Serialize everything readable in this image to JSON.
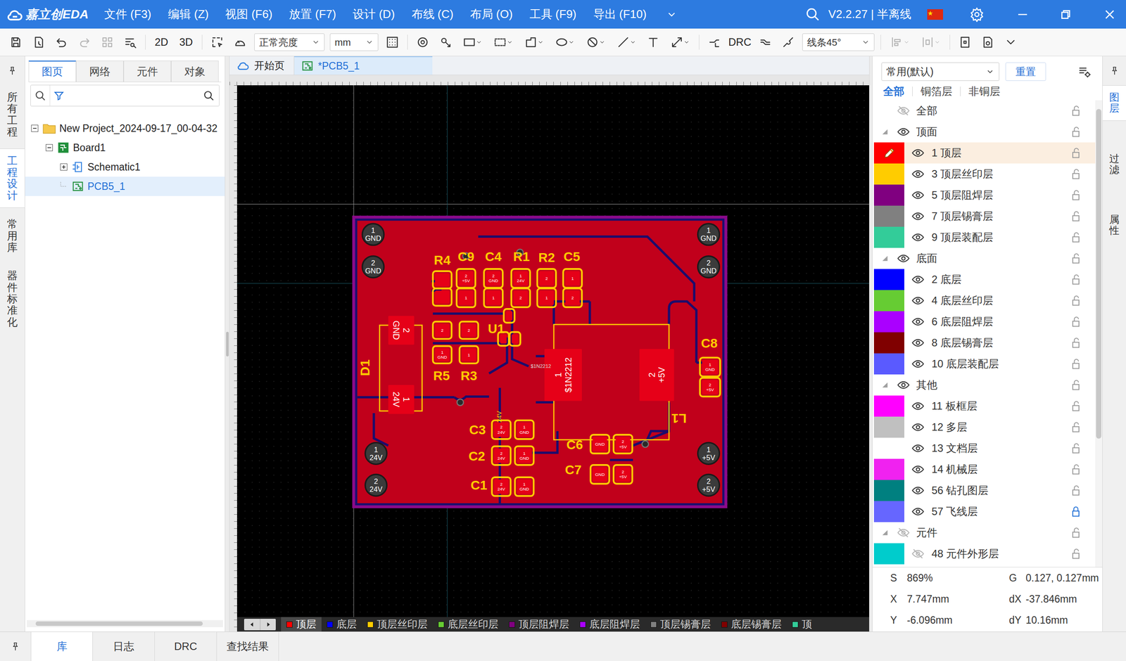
{
  "app": {
    "logo": "嘉立创EDA",
    "version": "V2.2.27 | 半离线"
  },
  "menu": [
    "文件 (F3)",
    "编辑 (Z)",
    "视图 (F6)",
    "放置 (F7)",
    "设计 (D)",
    "布线 (C)",
    "布局 (O)",
    "工具 (F9)",
    "导出 (F10)"
  ],
  "toolbar": {
    "view2d": "2D",
    "view3d": "3D",
    "brightness": "正常亮度",
    "units": "mm",
    "drc": "DRC",
    "route_mode": "线条45°"
  },
  "left_strip": [
    {
      "label": "所有工程",
      "selected": false
    },
    {
      "label": "工程设计",
      "selected": true
    },
    {
      "label": "常用库",
      "selected": false
    },
    {
      "label": "器件标准化",
      "selected": false
    }
  ],
  "left_tabs": [
    {
      "label": "图页",
      "selected": true
    },
    {
      "label": "网络",
      "selected": false
    },
    {
      "label": "元件",
      "selected": false
    },
    {
      "label": "对象",
      "selected": false
    }
  ],
  "tree": [
    {
      "label": "New Project_2024-09-17_00-04-32",
      "kind": "project",
      "depth": 0,
      "expanded": true,
      "selected": false
    },
    {
      "label": "Board1",
      "kind": "board",
      "depth": 1,
      "expanded": true,
      "selected": false
    },
    {
      "label": "Schematic1",
      "kind": "schematic",
      "depth": 2,
      "expanded": false,
      "selected": false
    },
    {
      "label": "PCB5_1",
      "kind": "pcb",
      "depth": 2,
      "selected": true
    }
  ],
  "doc_tabs": [
    {
      "label": "开始页",
      "kind": "home",
      "selected": false
    },
    {
      "label": "*PCB5_1",
      "kind": "pcb",
      "selected": true
    }
  ],
  "pcb": {
    "holes": [
      {
        "num": "1",
        "net": "GND"
      },
      {
        "num": "2",
        "net": "GND"
      },
      {
        "num": "1",
        "net": "GND"
      },
      {
        "num": "2",
        "net": "GND"
      },
      {
        "num": "1",
        "net": "24V"
      },
      {
        "num": "2",
        "net": "24V"
      },
      {
        "num": "1",
        "net": "+5V"
      },
      {
        "num": "2",
        "net": "+5V"
      }
    ],
    "components": [
      {
        "ref": "R4",
        "pads": [
          {},
          {}
        ]
      },
      {
        "ref": "C9",
        "pads": [
          {
            "num": "2",
            "net": "+5V"
          },
          {
            "num": "1"
          }
        ]
      },
      {
        "ref": "C4",
        "pads": [
          {
            "num": "2",
            "net": "GND"
          },
          {
            "num": "1"
          }
        ]
      },
      {
        "ref": "R1",
        "pads": [
          {
            "num": "1",
            "net": "24V"
          },
          {
            "num": "2"
          }
        ]
      },
      {
        "ref": "R2",
        "pads": [
          {
            "num": "2"
          },
          {
            "num": "1"
          }
        ]
      },
      {
        "ref": "C5",
        "pads": [
          {
            "num": "1"
          },
          {
            "num": "2"
          }
        ]
      },
      {
        "ref": "U1",
        "pads": [
          {},
          {},
          {}
        ]
      },
      {
        "ref": "R5",
        "pads": [
          {
            "num": "2"
          },
          {
            "num": "1",
            "net": "GND"
          }
        ]
      },
      {
        "ref": "R3",
        "pads": [
          {
            "num": "2"
          },
          {
            "num": "1"
          }
        ]
      },
      {
        "ref": "D1",
        "pads": [
          {
            "num": "2",
            "net": "GND"
          },
          {
            "num": "1",
            "net": "24V"
          }
        ]
      },
      {
        "ref": "L1",
        "pads": [
          {
            "num": "1",
            "net": "$1N2212"
          },
          {
            "num": "2",
            "net": "+5V"
          }
        ]
      },
      {
        "ref": "C8",
        "pads": [
          {
            "num": "1",
            "net": "GND"
          },
          {
            "num": "2",
            "net": "+5V"
          }
        ]
      },
      {
        "ref": "C3",
        "pads": [
          {
            "num": "2",
            "net": "24V"
          },
          {
            "num": "1",
            "net": "GND"
          }
        ]
      },
      {
        "ref": "C2",
        "pads": [
          {
            "num": "2",
            "net": "24V"
          },
          {
            "num": "1",
            "net": "GND"
          }
        ]
      },
      {
        "ref": "C1",
        "pads": [
          {
            "num": "2",
            "net": "24V"
          },
          {
            "num": "1",
            "net": "GND"
          }
        ]
      },
      {
        "ref": "C6",
        "pads": [
          {
            "net": "GND"
          },
          {
            "num": "2",
            "net": "+5V"
          }
        ]
      },
      {
        "ref": "C7",
        "pads": [
          {
            "net": "GND"
          },
          {
            "num": "2",
            "net": "+5V"
          }
        ]
      }
    ],
    "notes": [
      "$1N2212",
      "24V"
    ]
  },
  "layer_tabs": [
    {
      "label": "顶层",
      "color": "#ff0000",
      "selected": true
    },
    {
      "label": "底层",
      "color": "#0000ff",
      "selected": false
    },
    {
      "label": "顶层丝印层",
      "color": "#ffcc00",
      "selected": false
    },
    {
      "label": "底层丝印层",
      "color": "#66cc33",
      "selected": false
    },
    {
      "label": "顶层阻焊层",
      "color": "#800080",
      "selected": false
    },
    {
      "label": "底层阻焊层",
      "color": "#aa00ff",
      "selected": false
    },
    {
      "label": "顶层锡膏层",
      "color": "#808080",
      "selected": false
    },
    {
      "label": "底层锡膏层",
      "color": "#800000",
      "selected": false
    },
    {
      "label": "顶",
      "color": "#33cc99",
      "selected": false
    }
  ],
  "layers_panel": {
    "preset": "常用(默认)",
    "reset": "重置",
    "filters": [
      {
        "label": "全部",
        "selected": true
      },
      {
        "label": "铜箔层",
        "selected": false
      },
      {
        "label": "非铜层",
        "selected": false
      }
    ],
    "rows": [
      {
        "kind": "all",
        "label": "全部",
        "visible": false,
        "locked": false
      },
      {
        "kind": "group",
        "label": "顶面",
        "expanded": true,
        "visible": true,
        "locked": false
      },
      {
        "kind": "layer",
        "label": "1 顶层",
        "color": "#ff0000",
        "visible": true,
        "active": true,
        "locked": false
      },
      {
        "kind": "layer",
        "label": "3 顶层丝印层",
        "color": "#ffcc00",
        "visible": true,
        "active": false,
        "locked": false
      },
      {
        "kind": "layer",
        "label": "5 顶层阻焊层",
        "color": "#800080",
        "visible": true,
        "active": false,
        "locked": false
      },
      {
        "kind": "layer",
        "label": "7 顶层锡膏层",
        "color": "#808080",
        "visible": true,
        "active": false,
        "locked": false
      },
      {
        "kind": "layer",
        "label": "9 顶层装配层",
        "color": "#33cc99",
        "visible": true,
        "active": false,
        "locked": false
      },
      {
        "kind": "group",
        "label": "底面",
        "expanded": true,
        "visible": true,
        "locked": false
      },
      {
        "kind": "layer",
        "label": "2 底层",
        "color": "#0000ff",
        "visible": true,
        "active": false,
        "locked": false
      },
      {
        "kind": "layer",
        "label": "4 底层丝印层",
        "color": "#66cc33",
        "visible": true,
        "active": false,
        "locked": false
      },
      {
        "kind": "layer",
        "label": "6 底层阻焊层",
        "color": "#aa00ff",
        "visible": true,
        "active": false,
        "locked": false
      },
      {
        "kind": "layer",
        "label": "8 底层锡膏层",
        "color": "#800000",
        "visible": true,
        "active": false,
        "locked": false
      },
      {
        "kind": "layer",
        "label": "10 底层装配层",
        "color": "#5a5aff",
        "visible": true,
        "active": false,
        "locked": false
      },
      {
        "kind": "group",
        "label": "其他",
        "expanded": true,
        "visible": true,
        "locked": false
      },
      {
        "kind": "layer",
        "label": "11 板框层",
        "color": "#ff00ff",
        "visible": true,
        "active": false,
        "locked": false
      },
      {
        "kind": "layer",
        "label": "12 多层",
        "color": "#c0c0c0",
        "visible": true,
        "active": false,
        "locked": false
      },
      {
        "kind": "layer",
        "label": "13 文档层",
        "color": "#ffffff",
        "visible": true,
        "active": false,
        "locked": false
      },
      {
        "kind": "layer",
        "label": "14 机械层",
        "color": "#f022f0",
        "visible": true,
        "active": false,
        "locked": false
      },
      {
        "kind": "layer",
        "label": "56 钻孔图层",
        "color": "#008080",
        "visible": true,
        "active": false,
        "locked": false
      },
      {
        "kind": "layer",
        "label": "57 飞线层",
        "color": "#6666ff",
        "visible": true,
        "active": false,
        "locked": true
      },
      {
        "kind": "group",
        "label": "元件",
        "expanded": true,
        "visible": false,
        "locked": false
      },
      {
        "kind": "layer",
        "label": "48 元件外形层",
        "color": "#00cccc",
        "visible": false,
        "active": false,
        "locked": false
      }
    ]
  },
  "status": [
    {
      "key": "S",
      "value": "869%"
    },
    {
      "key": "G",
      "value": "0.127, 0.127mm"
    },
    {
      "key": "X",
      "value": "7.747mm"
    },
    {
      "key": "dX",
      "value": "-37.846mm"
    },
    {
      "key": "Y",
      "value": "-6.096mm"
    },
    {
      "key": "dY",
      "value": "10.16mm"
    }
  ],
  "right_strip": [
    {
      "label": "图层",
      "selected": true
    },
    {
      "label": "过滤",
      "selected": false
    },
    {
      "label": "属性",
      "selected": false
    }
  ],
  "bottom_tabs": [
    {
      "label": "库",
      "selected": true
    },
    {
      "label": "日志",
      "selected": false
    },
    {
      "label": "DRC",
      "selected": false
    },
    {
      "label": "查找结果",
      "selected": false
    }
  ]
}
